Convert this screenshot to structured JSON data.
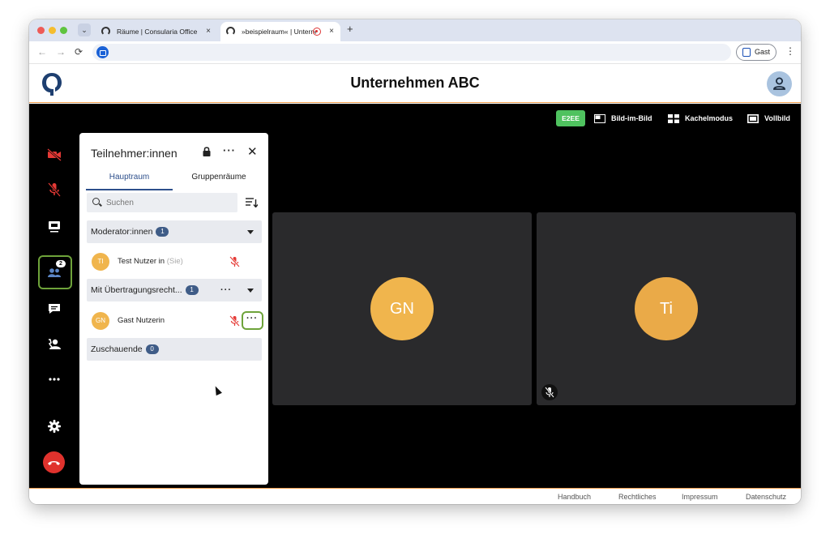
{
  "browser": {
    "tabs": [
      {
        "title": "Räume | Consularia Office",
        "close": "×"
      },
      {
        "title": "»beispielraum« | Unternehmen ABC",
        "close": "×"
      }
    ],
    "new_tab": "+",
    "nav": {
      "back": "←",
      "forward": "→",
      "reload": "⟳"
    },
    "profile_label": "Gast",
    "menu_glyph": "⋮"
  },
  "app": {
    "title": "Unternehmen ABC"
  },
  "topbar": {
    "e2ee": "E2EE",
    "pip": "Bild-im-Bild",
    "tile_mode": "Kachelmodus",
    "fullscreen": "Vollbild"
  },
  "sidebar": {
    "participants_count": "2"
  },
  "panel": {
    "title": "Teilnehmer:innen",
    "more": "···",
    "close": "✕",
    "tabs": [
      "Hauptraum",
      "Gruppenräume"
    ],
    "search_placeholder": "Suchen",
    "sections": [
      {
        "label": "Moderator:innen",
        "count": "1"
      },
      {
        "label": "Mit Übertragungsrecht...",
        "count": "1"
      },
      {
        "label": "Zuschauende",
        "count": "0"
      }
    ],
    "participants": [
      {
        "initials": "TI",
        "name": "Test Nutzer in",
        "suffix": "(Sie)"
      },
      {
        "initials": "GN",
        "name": "Gast Nutzerin",
        "suffix": ""
      }
    ],
    "row_more": "···"
  },
  "tiles": [
    {
      "initials": "GN"
    },
    {
      "initials": "Ti"
    }
  ],
  "footer": {
    "links": [
      "Handbuch",
      "Rechtliches",
      "Impressum",
      "Datenschutz"
    ]
  },
  "colors": {
    "accent_green": "#6ea33a",
    "e2ee_green": "#4fc25f",
    "avatar_orange": "#f0b54d",
    "hangup_red": "#e0322d",
    "mute_red": "#e53935",
    "primary_blue": "#2d4f8b"
  },
  "icons": [
    "camera-off-icon",
    "mic-off-icon",
    "screenshare-icon",
    "participants-icon",
    "chat-icon",
    "contact-icon",
    "more-icon",
    "settings-icon",
    "hangup-icon",
    "lock-icon",
    "search-icon",
    "sort-icon"
  ]
}
